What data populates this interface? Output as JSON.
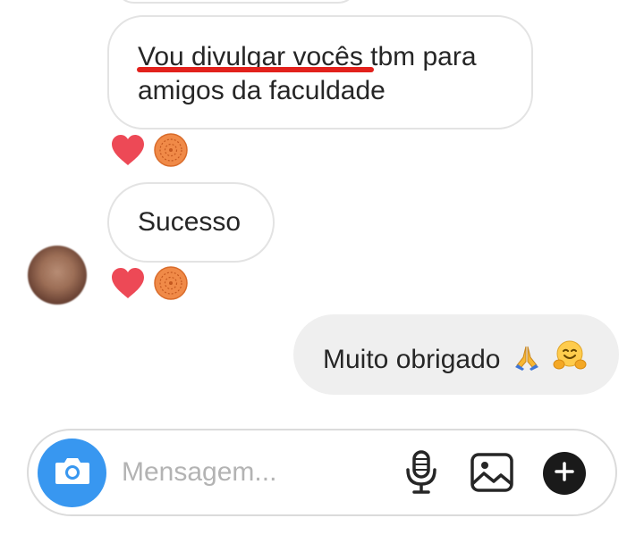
{
  "thread": {
    "messages": [
      {
        "direction": "received",
        "text": "Vou divulgar vocês tbm para amigos da faculdade",
        "reactions": [
          "heart",
          "avatar-sticker"
        ]
      },
      {
        "direction": "received",
        "text": "Sucesso",
        "reactions": [
          "heart",
          "avatar-sticker"
        ]
      },
      {
        "direction": "sent",
        "text": "Muito obrigado",
        "emojis": [
          "folded-hands",
          "hugging-face"
        ]
      }
    ]
  },
  "composer": {
    "placeholder": "Mensagem...",
    "value": ""
  },
  "colors": {
    "accent_blue": "#3897f0",
    "reaction_heart": "#ed4956",
    "underline_annotation": "#e2211c",
    "sent_bubble": "#efefef",
    "received_border": "#e3e3e3"
  },
  "icons": [
    "camera-icon",
    "microphone-icon",
    "image-icon",
    "plus-icon",
    "heart-icon",
    "reaction-sticker-icon",
    "folded-hands-emoji",
    "hugging-face-emoji"
  ]
}
